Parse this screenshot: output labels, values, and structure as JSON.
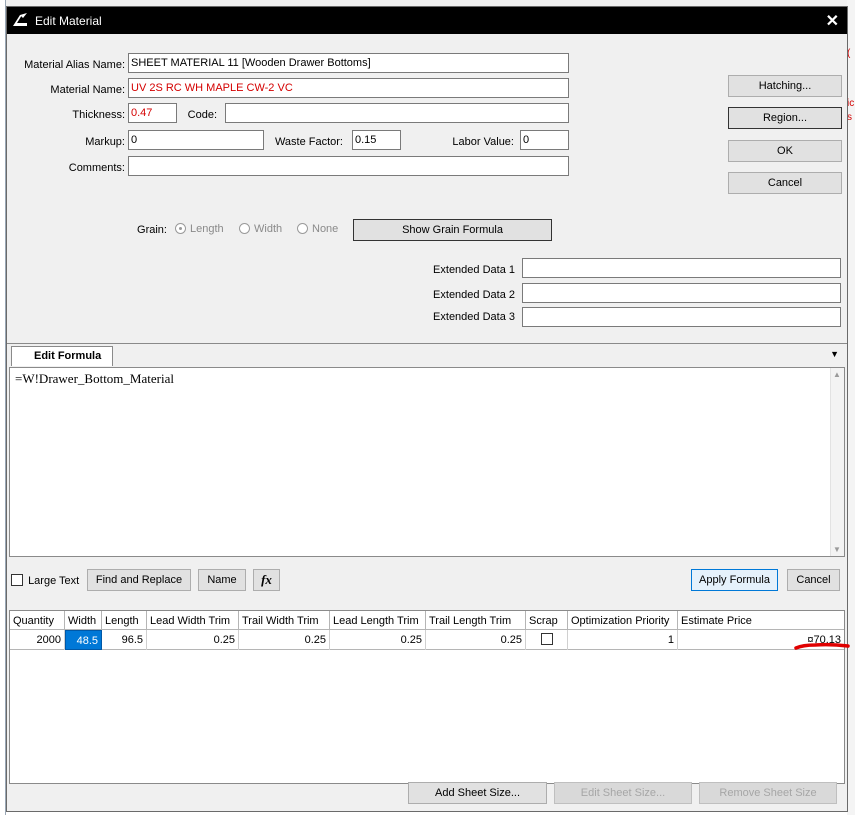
{
  "title": "Edit Material",
  "fields": {
    "alias_label": "Material Alias Name:",
    "alias_value": "SHEET MATERIAL 11 [Wooden Drawer Bottoms]",
    "name_label": "Material Name:",
    "name_value": "UV 2S RC WH MAPLE CW-2 VC",
    "thickness_label": "Thickness:",
    "thickness_value": "0.47",
    "code_label": "Code:",
    "code_value": "",
    "markup_label": "Markup:",
    "markup_value": "0",
    "waste_label": "Waste Factor:",
    "waste_value": "0.15",
    "labor_label": "Labor Value:",
    "labor_value": "0",
    "comments_label": "Comments:",
    "comments_value": ""
  },
  "side_buttons": {
    "hatching": "Hatching...",
    "region": "Region...",
    "ok": "OK",
    "cancel": "Cancel"
  },
  "grain": {
    "label": "Grain:",
    "options": [
      "Length",
      "Width",
      "None"
    ],
    "selected": "Length",
    "show_formula": "Show Grain Formula"
  },
  "extended": {
    "label1": "Extended Data 1",
    "label2": "Extended Data 2",
    "label3": "Extended Data 3"
  },
  "formula": {
    "tab_label": "Edit Formula",
    "text": "=W!Drawer_Bottom_Material"
  },
  "toolbar": {
    "large_text": "Large Text",
    "find_replace": "Find and Replace",
    "name": "Name",
    "fx": "fx",
    "apply": "Apply Formula",
    "cancel": "Cancel"
  },
  "grid": {
    "columns": [
      "Quantity",
      "Width",
      "Length",
      "Lead Width Trim",
      "Trail Width Trim",
      "Lead Length Trim",
      "Trail Length Trim",
      "Scrap",
      "Optimization Priority",
      "Estimate Price"
    ],
    "rows": [
      {
        "quantity": "2000",
        "width": "48.5",
        "length": "96.5",
        "lead_width_trim": "0.25",
        "trail_width_trim": "0.25",
        "lead_length_trim": "0.25",
        "trail_length_trim": "0.25",
        "scrap": false,
        "optimization_priority": "1",
        "estimate_price": "¤70.13"
      }
    ]
  },
  "bottom_buttons": {
    "add": "Add Sheet Size...",
    "edit": "Edit Sheet Size...",
    "remove": "Remove Sheet Size"
  },
  "colors": {
    "titlebar": "#000000",
    "required_text": "#d40000",
    "selection": "#0078d7",
    "annotation": "#e00000"
  }
}
